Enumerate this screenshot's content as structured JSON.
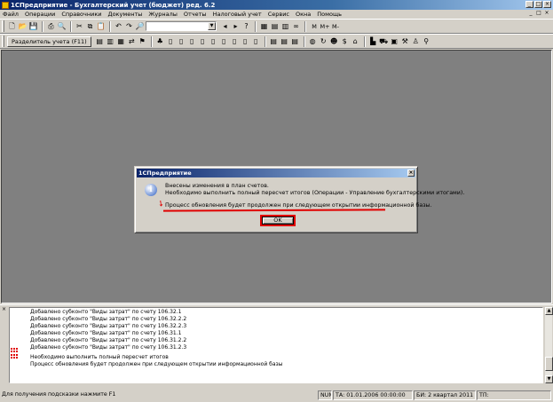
{
  "window": {
    "title": "1СПредприятие - Бухгалтерский учет (бюджет) ред. 6.2",
    "controls": [
      "_",
      "□",
      "×"
    ]
  },
  "menu": {
    "items": [
      "Файл",
      "Операции",
      "Справочники",
      "Документы",
      "Журналы",
      "Отчеты",
      "Налоговый учет",
      "Сервис",
      "Окна",
      "Помощь"
    ]
  },
  "toolbar": {
    "memory_buttons": [
      "M",
      "M+",
      "M-"
    ],
    "period_button": "Разделитель учета (F11)"
  },
  "dialog": {
    "title": "1СПредприятие",
    "close": "×",
    "icon_glyph": "i",
    "line1": "Внесены изменения в план счетов.",
    "line2": "Необходимо выполнить полный пересчет итогов (Операции - Управление бухгалтерскими итогами).",
    "line3": "Процесс обновления будет продолжен при следующем открытии информационной базы.",
    "ok": "OK"
  },
  "messages": {
    "lines": [
      "Добавлено субконто \"Виды затрат\" по счету 106.32.1",
      "Добавлено субконто \"Виды затрат\" по счету 106.32.2.2",
      "Добавлено субконто \"Виды затрат\" по счету 106.32.2.3",
      "Добавлено субконто \"Виды затрат\" по счету 106.31.1",
      "Добавлено субконто \"Виды затрат\" по счету 106.31.2.2",
      "Добавлено субконто \"Виды затрат\" по счету 106.31.2.3",
      "Необходимо выполнить полный пересчет итогов",
      "Процесс обновления будет продолжен при следующем открытии информационной базы"
    ]
  },
  "status": {
    "hint": "Для получения подсказки нажмите F1",
    "num": "NUM",
    "ta": "ТА: 01.01.2006  00:00:00",
    "bi": "БИ: 2 квартал 2011 г.",
    "tp": "ТП:"
  },
  "colors": {
    "title_bar": "#0a246a",
    "face": "#d4d0c8",
    "workspace": "#808080",
    "annotation": "#e00000"
  }
}
